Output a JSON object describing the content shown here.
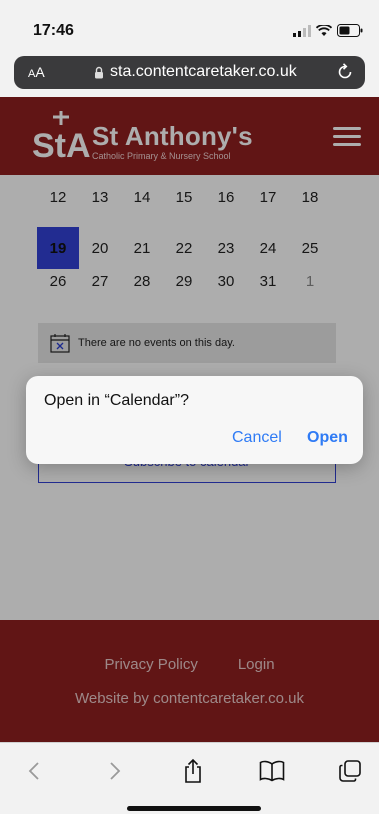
{
  "status_bar": {
    "time": "17:46"
  },
  "address_bar": {
    "aa_small": "A",
    "aa_large": "A",
    "url": "sta.contentcaretaker.co.uk"
  },
  "site": {
    "name": "St Anthony's",
    "subtitle": "Catholic Primary & Nursery School",
    "logo_letters": "StA"
  },
  "calendar": {
    "rows": [
      [
        {
          "day": "12"
        },
        {
          "day": "13"
        },
        {
          "day": "14"
        },
        {
          "day": "15"
        },
        {
          "day": "16"
        },
        {
          "day": "17"
        },
        {
          "day": "18"
        }
      ],
      [
        {
          "day": "19",
          "selected": true
        },
        {
          "day": "20"
        },
        {
          "day": "21"
        },
        {
          "day": "22"
        },
        {
          "day": "23"
        },
        {
          "day": "24"
        },
        {
          "day": "25"
        }
      ],
      [
        {
          "day": "26"
        },
        {
          "day": "27"
        },
        {
          "day": "28"
        },
        {
          "day": "29"
        },
        {
          "day": "30"
        },
        {
          "day": "31"
        },
        {
          "day": "1",
          "muted": true
        }
      ]
    ],
    "no_events_text": "There are no events on this day.",
    "subscribe_label": "Subscribe to calendar"
  },
  "footer": {
    "privacy_label": "Privacy Policy",
    "login_label": "Login",
    "credit": "Website by contentcaretaker.co.uk"
  },
  "alert": {
    "title": "Open in “Calendar”?",
    "cancel_label": "Cancel",
    "open_label": "Open"
  },
  "colors": {
    "brand": "#8f1f1f",
    "selected_day": "#3342d6",
    "ios_blue": "#2f7bf5"
  },
  "toolbar": {
    "icons": [
      "back-icon",
      "forward-icon",
      "share-icon",
      "bookmarks-icon",
      "tabs-icon"
    ]
  }
}
